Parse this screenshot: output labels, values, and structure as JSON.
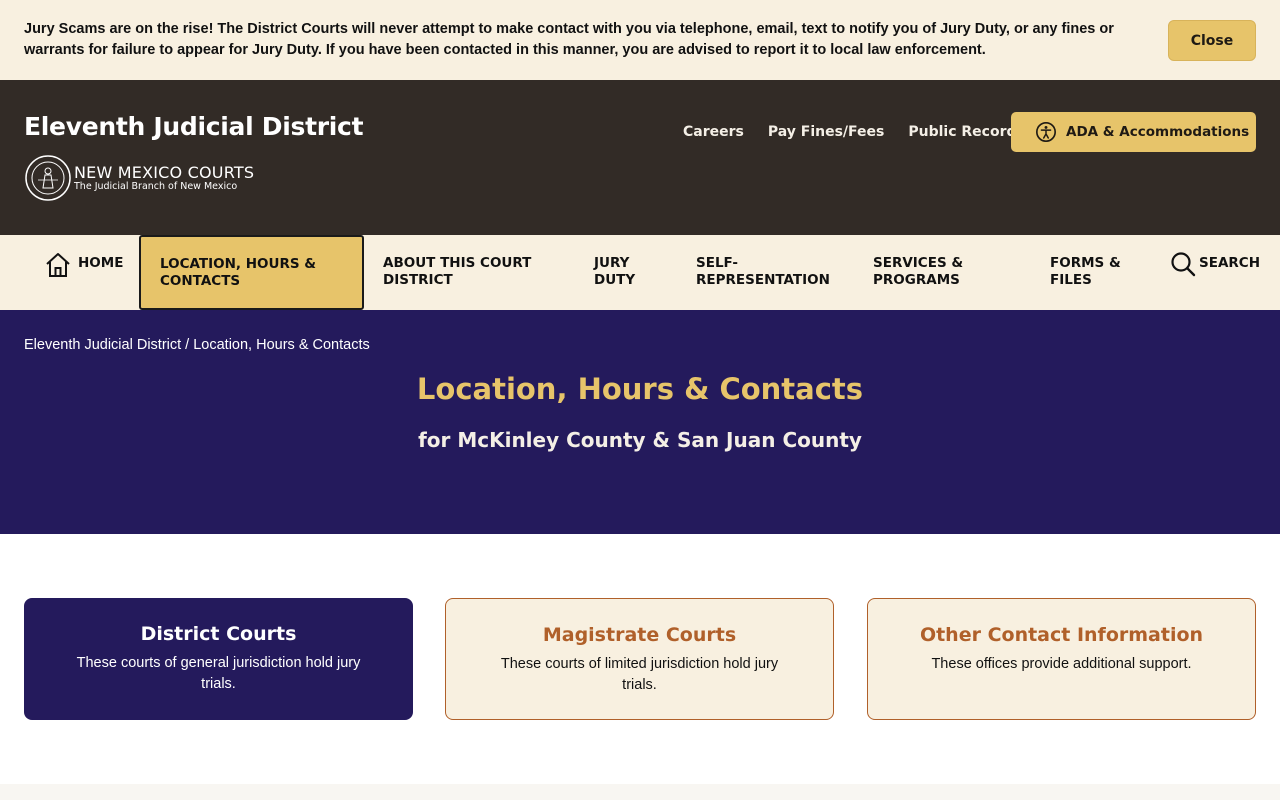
{
  "alert": {
    "text": "Jury Scams are on the rise! The District Courts will never attempt to make contact with you via telephone, email, text to notify you of Jury Duty, or any fines or warrants for failure to appear for Jury Duty. If you have been contacted in this manner, you are advised to report it to local law enforcement.",
    "close_label": "Close"
  },
  "header": {
    "site_title": "Eleventh Judicial District",
    "logo_main": "NEW MEXICO COURTS",
    "logo_sub": "The Judicial Branch of New Mexico",
    "util_links": [
      "Careers",
      "Pay Fines/Fees",
      "Public Records"
    ],
    "ada_label": "ADA & Accommodations"
  },
  "nav": {
    "items": [
      {
        "label": "Home"
      },
      {
        "label": "Location, Hours & Contacts",
        "active": true
      },
      {
        "label": "About this Court District"
      },
      {
        "label": "Jury Duty"
      },
      {
        "label": "Self-Representation"
      },
      {
        "label": "Services & Programs"
      },
      {
        "label": "Forms & Files"
      },
      {
        "label": "Search"
      }
    ]
  },
  "breadcrumb": "Eleventh Judicial District / Location, Hours & Contacts",
  "hero": {
    "title": "Location, Hours & Contacts",
    "subtitle": "for McKinley County & San Juan County"
  },
  "cards": [
    {
      "title": "District Courts",
      "desc": "These courts of general jurisdiction hold jury trials."
    },
    {
      "title": "Magistrate Courts",
      "desc": "These courts of limited jurisdiction hold jury trials."
    },
    {
      "title": "Other Contact Information",
      "desc": "These offices provide additional support."
    }
  ],
  "colors": {
    "accent_gold": "#e7c46a",
    "header_bg": "#322b26",
    "hero_bg": "#241a5c",
    "cream": "#f8f0e0",
    "rust": "#b0602a"
  }
}
